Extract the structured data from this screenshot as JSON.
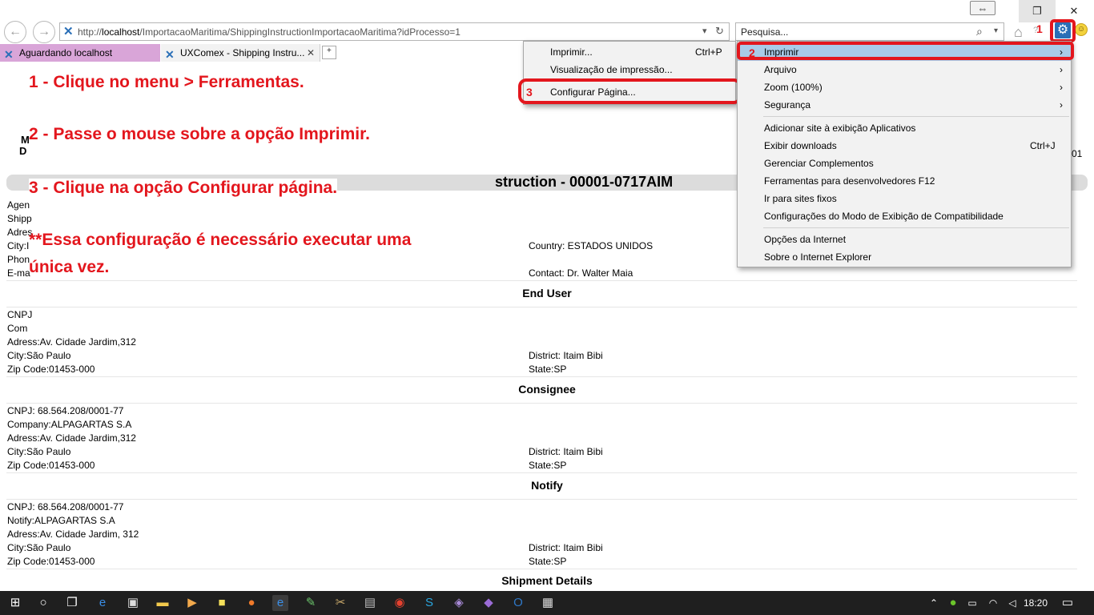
{
  "browser": {
    "address_url_prefix": "http://",
    "address_url_host": "localhost",
    "address_url_path": "/ImportacaoMaritima/ShippingInstructionImportacaoMaritima?idProcesso=1",
    "search_placeholder": "Pesquisa...",
    "tabs": [
      {
        "label": "Aguardando localhost"
      },
      {
        "label": "UXComex - Shipping Instru..."
      }
    ]
  },
  "instructions": {
    "step1": "1 - Clique no menu > Ferramentas.",
    "step2": "2 - Passe o mouse sobre a opção Imprimir.",
    "step3": "3 - Clique na opção Configurar página.",
    "note_line1": "**Essa configuração é necessário executar uma",
    "note_line2": "única vez."
  },
  "markers": {
    "one": "1",
    "two": "2",
    "three": "3"
  },
  "tools_menu": {
    "items": [
      {
        "label": "Imprimir",
        "arrow": "›"
      },
      {
        "label": "Arquivo",
        "arrow": "›"
      },
      {
        "label": "Zoom (100%)",
        "arrow": "›"
      },
      {
        "label": "Segurança",
        "arrow": "›"
      },
      {
        "label": "Adicionar site à exibição Aplicativos"
      },
      {
        "label": "Exibir downloads",
        "shortcut": "Ctrl+J"
      },
      {
        "label": "Gerenciar Complementos"
      },
      {
        "label": "Ferramentas para desenvolvedores F12"
      },
      {
        "label": "Ir para sites fixos"
      },
      {
        "label": "Configurações do Modo de Exibição de Compatibilidade"
      },
      {
        "label": "Opções da Internet"
      },
      {
        "label": "Sobre o Internet Explorer"
      }
    ]
  },
  "print_submenu": {
    "items": [
      {
        "label": "Imprimir...",
        "shortcut": "Ctrl+P"
      },
      {
        "label": "Visualização de impressão..."
      },
      {
        "label": "Configurar Página..."
      }
    ]
  },
  "document": {
    "title_fragment": "struction - 00001-0717AIM",
    "left_fragments": [
      "M",
      "D"
    ],
    "right_fragment": "01",
    "agent_fragments": [
      "Agen",
      "Shipp",
      "Adres",
      "City:I",
      "Phon",
      "E-ma"
    ],
    "country": "Country: ESTADOS UNIDOS",
    "contact": "Contact: Dr. Walter Maia",
    "end_user": {
      "heading": "End User",
      "cnpj_fragment": "CNPJ",
      "company_fragment": "Com",
      "adress": "Adress:Av. Cidade Jardim,312",
      "city": "City:São Paulo",
      "district": "District: Itaim Bibi",
      "zip": "Zip Code:01453-000",
      "state": "State:SP"
    },
    "consignee": {
      "heading": "Consignee",
      "cnpj": "CNPJ: 68.564.208/0001-77",
      "company": "Company:ALPAGARTAS S.A",
      "adress": "Adress:Av. Cidade Jardim,312",
      "city": "City:São Paulo",
      "district": "District: Itaim Bibi",
      "zip": "Zip Code:01453-000",
      "state": "State:SP"
    },
    "notify": {
      "heading": "Notify",
      "cnpj": "CNPJ: 68.564.208/0001-77",
      "notify": "Notify:ALPAGARTAS S.A",
      "adress": "Adress:Av. Cidade Jardim, 312",
      "city": "City:São Paulo",
      "district": "District: Itaim Bibi",
      "zip": "Zip Code:01453-000",
      "state": "State:SP"
    },
    "shipment_heading": "Shipment Details"
  },
  "taskbar": {
    "clock": "18:20"
  }
}
